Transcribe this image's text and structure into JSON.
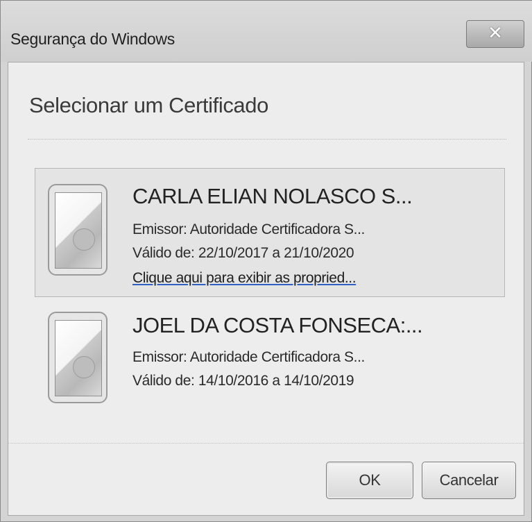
{
  "window": {
    "title": "Segurança do Windows",
    "close_icon": "close-icon"
  },
  "dialog": {
    "heading": "Selecionar um Certificado"
  },
  "certificates": [
    {
      "name": "CARLA ELIAN NOLASCO S...",
      "issuer": "Emissor: Autoridade Certificadora S...",
      "validity": "Válido de: 22/10/2017 a 21/10/2020",
      "link": "Clique aqui para exibir as propried...",
      "selected": true,
      "icon": "certificate-icon"
    },
    {
      "name": "JOEL DA COSTA FONSECA:...",
      "issuer": "Emissor: Autoridade Certificadora S...",
      "validity": "Válido de: 14/10/2016 a 14/10/2019",
      "selected": false,
      "icon": "certificate-icon"
    }
  ],
  "buttons": {
    "ok": "OK",
    "cancel": "Cancelar"
  }
}
